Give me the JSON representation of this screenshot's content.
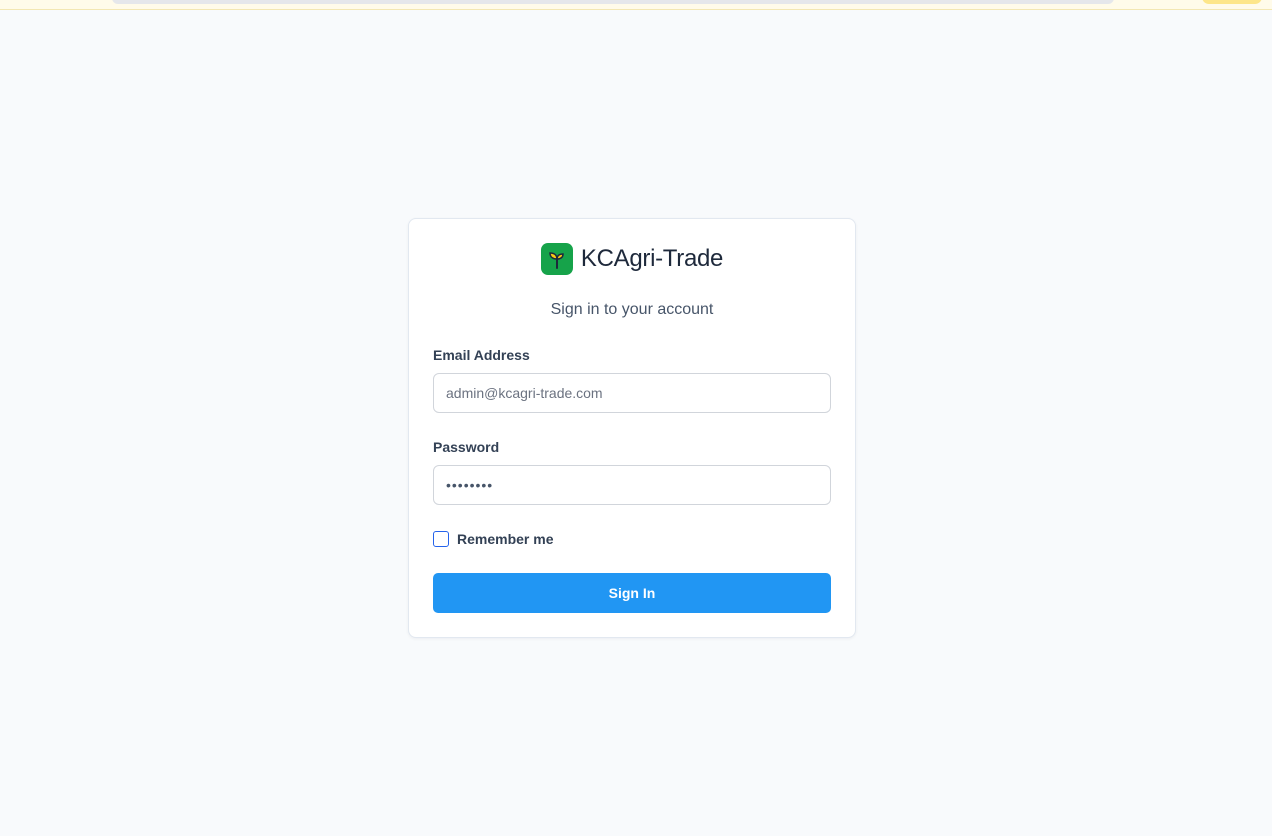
{
  "app": {
    "brand_name": "KCAgri-Trade",
    "logo_icon": "sprout-icon",
    "brand_color": "#16a34a"
  },
  "login": {
    "subtitle": "Sign in to your account",
    "email_label": "Email Address",
    "email_placeholder": "admin@kcagri-trade.com",
    "email_value": "",
    "password_label": "Password",
    "password_value": "••••••••",
    "remember_label": "Remember me",
    "remember_checked": false,
    "submit_label": "Sign In",
    "submit_color": "#2196f3"
  }
}
